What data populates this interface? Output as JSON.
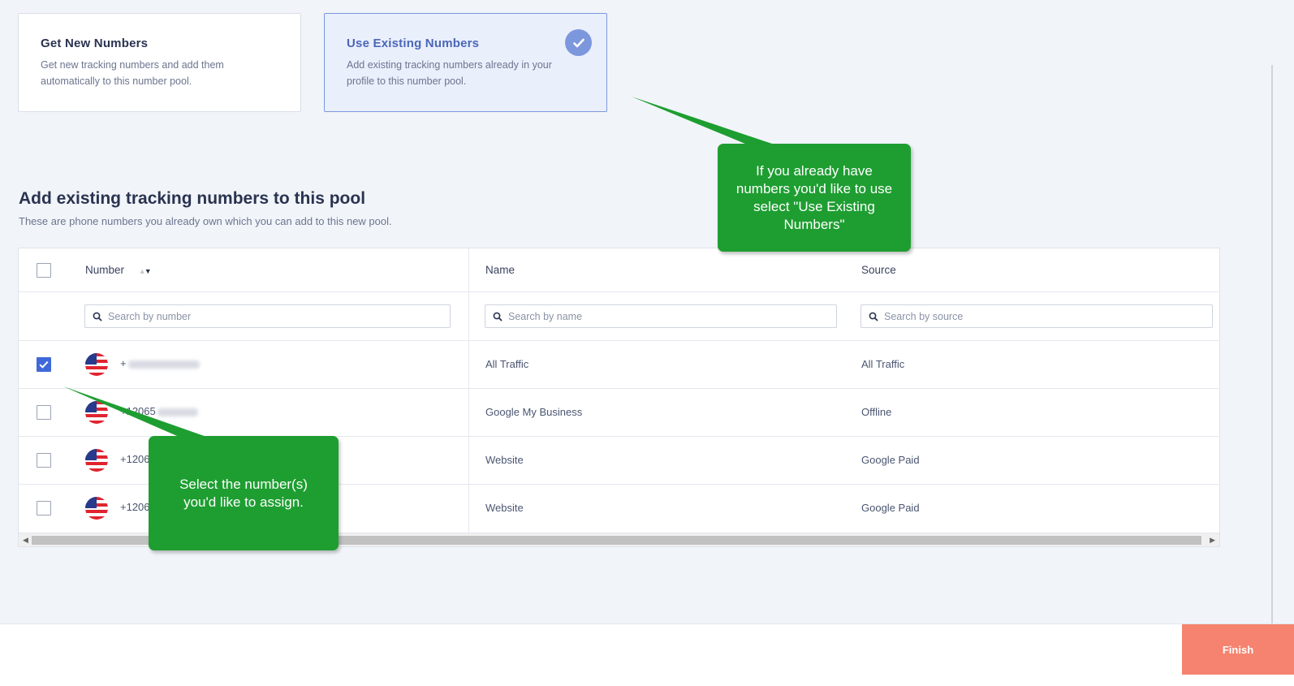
{
  "options": {
    "new": {
      "title": "Get New Numbers",
      "desc_line1": "Get new tracking numbers and add them",
      "desc_line2": "automatically to this number pool."
    },
    "existing": {
      "title": "Use Existing Numbers",
      "desc_line1": "Add existing tracking numbers already in your",
      "desc_line2": "profile to this number pool.",
      "selected": true
    }
  },
  "section": {
    "title": "Add existing tracking numbers to this pool",
    "subtitle": "These are phone numbers you already own which you can add to this new pool."
  },
  "table": {
    "headers": {
      "number": "Number",
      "name": "Name",
      "source": "Source"
    },
    "search": {
      "number": "Search by number",
      "name": "Search by name",
      "source": "Search by source"
    },
    "rows": [
      {
        "number": "+",
        "name": "All Traffic",
        "source": "All Traffic",
        "checked": true
      },
      {
        "number": "+12065",
        "name": "Google My Business",
        "source": "Offline",
        "checked": false
      },
      {
        "number": "+1206",
        "name": "Website",
        "source": "Google Paid",
        "checked": false
      },
      {
        "number": "+1206",
        "name": "Website",
        "source": "Google Paid",
        "checked": false
      }
    ]
  },
  "callouts": {
    "existing": "If you already have numbers you'd like to use select \"Use Existing Numbers\"",
    "select": "Select the number(s) you'd like to assign."
  },
  "footer": {
    "finish_label": "Finish"
  },
  "colors": {
    "accent": "#7d97dd",
    "checkbox": "#3f69d8",
    "callout": "#1e9e31",
    "finish": "#f5836f"
  }
}
